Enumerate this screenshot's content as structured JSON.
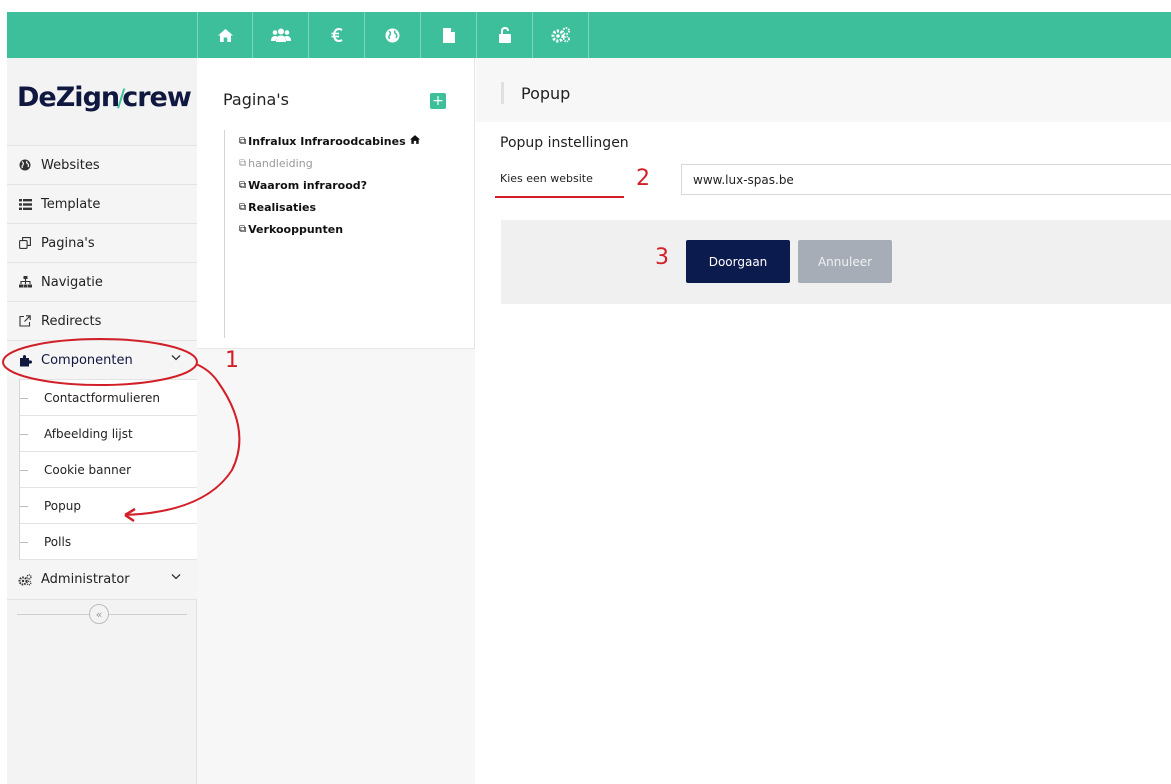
{
  "topbar": {
    "icons": [
      "home-icon",
      "users-icon",
      "euro-icon",
      "globe-icon",
      "file-icon",
      "unlock-icon",
      "gears-icon"
    ]
  },
  "brand": {
    "logo_part1": "De",
    "logo_part2": "Zign",
    "logo_slash": "/",
    "logo_part3": "crew"
  },
  "sidebar": {
    "items": [
      {
        "label": "Websites",
        "icon": "globe-icon"
      },
      {
        "label": "Template",
        "icon": "list-icon"
      },
      {
        "label": "Pagina's",
        "icon": "copy-icon"
      },
      {
        "label": "Navigatie",
        "icon": "sitemap-icon"
      },
      {
        "label": "Redirects",
        "icon": "external-link-icon"
      },
      {
        "label": "Componenten",
        "icon": "puzzle-icon"
      }
    ],
    "sub_items": [
      "Contactformulieren",
      "Afbeelding lijst",
      "Cookie banner",
      "Popup",
      "Polls"
    ],
    "admin": {
      "label": "Administrator",
      "icon": "gears-icon"
    },
    "collapse_glyph": "«"
  },
  "pages_panel": {
    "title": "Pagina's",
    "add_glyph": "+",
    "pages": [
      {
        "label": "Infralux Infraroodcabines",
        "dim": false,
        "home": true
      },
      {
        "label": "handleiding",
        "dim": true,
        "home": false
      },
      {
        "label": "Waarom infrarood?",
        "dim": false,
        "home": false
      },
      {
        "label": "Realisaties",
        "dim": false,
        "home": false
      },
      {
        "label": "Verkooppunten",
        "dim": false,
        "home": false
      }
    ]
  },
  "main": {
    "title": "Popup",
    "section_title": "Popup instellingen",
    "field_label": "Kies een website",
    "website_value": "www.lux-spas.be",
    "go_label": "Doorgaan",
    "cancel_label": "Annuleer"
  },
  "annotations": {
    "step1": "1",
    "step2": "2",
    "step3": "3",
    "color": "#d21f27"
  },
  "colors": {
    "accent": "#3dbf9b",
    "primary_button": "#0c1b4d",
    "disabled_button": "#a7adb6"
  }
}
